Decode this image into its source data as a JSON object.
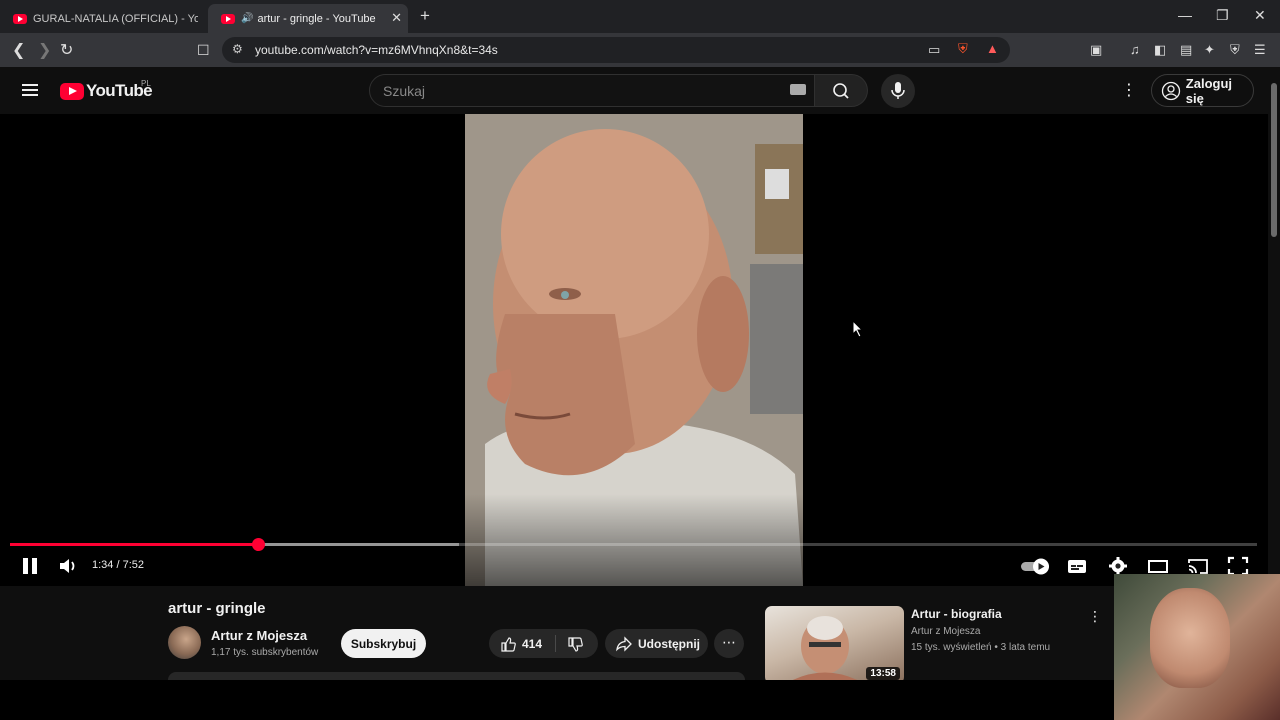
{
  "browser": {
    "tabs": [
      {
        "title": "GURAL-NATALIA (OFFICIAL) - YouTube",
        "active": false
      },
      {
        "title": "artur - gringle - YouTube",
        "active": true,
        "audio": true
      }
    ],
    "url": "youtube.com/watch?v=mz6MVhnqXn8&t=34s",
    "brave_badge": "4"
  },
  "youtube": {
    "logo_text": "YouTube",
    "country_code": "PL",
    "search_placeholder": "Szukaj",
    "signin_label": "Zaloguj się"
  },
  "player": {
    "current_time": "1:34",
    "duration": "7:52",
    "time_display": "1:34 / 7:52",
    "progress": 0.199,
    "buffered": 0.36,
    "state": "playing"
  },
  "video": {
    "title": "artur - gringle",
    "channel": "Artur z Mojesza",
    "subscribers": "1,17 tys. subskrybentów",
    "subscribe_label": "Subskrybuj",
    "likes": "414",
    "share_label": "Udostępnij"
  },
  "recommended": [
    {
      "title": "Artur - biografia",
      "channel": "Artur z Mojesza",
      "meta": "15 tys. wyświetleń • 3 lata temu",
      "duration": "13:58"
    }
  ],
  "colors": {
    "accent": "#ff0033",
    "background": "#0f0f0f",
    "chrome": "#35363a"
  }
}
